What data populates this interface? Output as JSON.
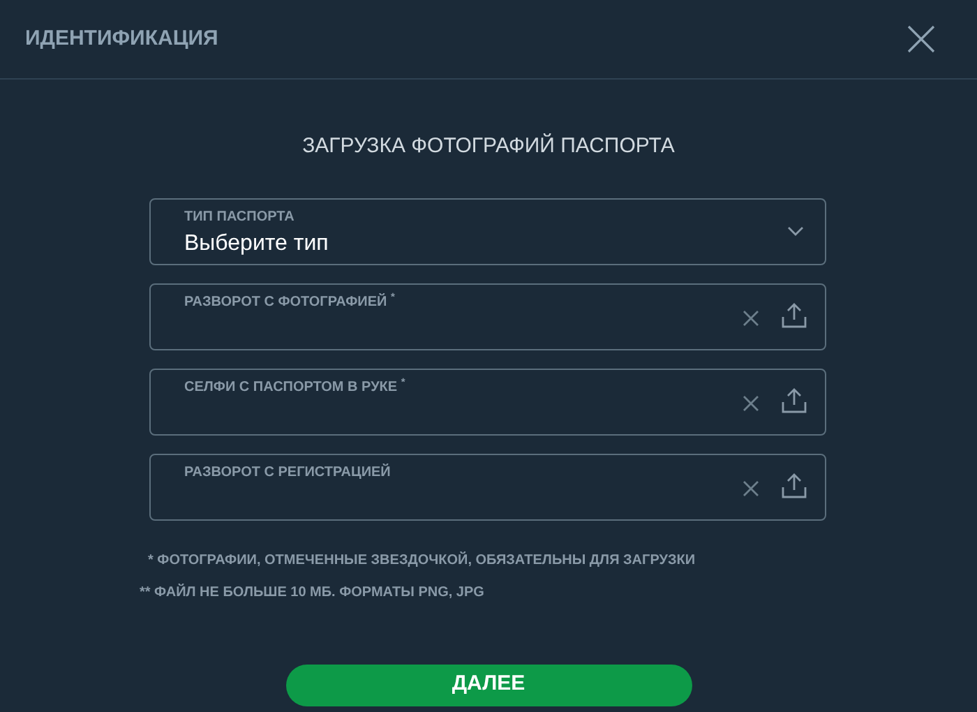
{
  "window": {
    "title": "ИДЕНТИФИКАЦИЯ"
  },
  "heading": "ЗАГРУЗКА ФОТОГРАФИЙ ПАСПОРТА",
  "fields": [
    {
      "kind": "select",
      "label": "ТИП ПАСПОРТА",
      "value": "Выберите тип"
    },
    {
      "kind": "upload",
      "label": "РАЗВОРОТ С ФОТОГРАФИЕЙ $^{*}$"
    },
    {
      "kind": "upload",
      "label": "СЕЛФИ С ПАСПОРТОМ В РУКЕ $^{*}$"
    },
    {
      "kind": "upload",
      "label": "РАЗВОРОТ С РЕГИСТРАЦИЕЙ"
    }
  ],
  "notes": [
    "* ФОТОГРАФИИ, ОТМЕЧЕННЫЕ ЗВЕЗДОЧКОЙ, ОБЯЗАТЕЛЬНЫ ДЛЯ ЗАГРУЗКИ",
    "** ФАЙЛ НЕ БОЛЬШЕ 10 МБ. ФОРМАТЫ PNG, JPG"
  ],
  "button": "ДАЛЕЕ"
}
